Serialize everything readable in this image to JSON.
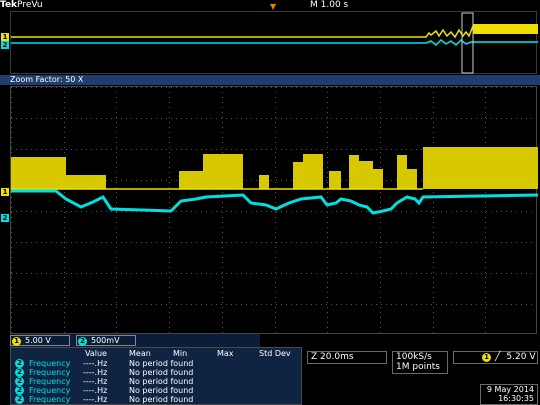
{
  "header": {
    "brand": "Tek",
    "mode": "PreVu",
    "timebase": "M 1.00 s"
  },
  "zoom": {
    "label": "Zoom Factor: 50 X"
  },
  "channels": [
    {
      "num": "1",
      "scale": "5.00 V",
      "color": "#f0e000"
    },
    {
      "num": "2",
      "scale": "500mV",
      "color": "#00e0e0"
    }
  ],
  "measurements": {
    "headers": [
      "Value",
      "Mean",
      "Min",
      "Max",
      "Std Dev"
    ],
    "rows": [
      {
        "ch": "2",
        "name": "Frequency",
        "value": "----.Hz",
        "status": "No period found"
      },
      {
        "ch": "2",
        "name": "Frequency",
        "value": "----.Hz",
        "status": "No period found"
      },
      {
        "ch": "2",
        "name": "Frequency",
        "value": "----.Hz",
        "status": "No period found"
      },
      {
        "ch": "2",
        "name": "Frequency",
        "value": "----.Hz",
        "status": "No period found"
      },
      {
        "ch": "2",
        "name": "Frequency",
        "value": "----.Hz",
        "status": "No period found"
      }
    ]
  },
  "horizontal": {
    "position": "Z 20.0ms",
    "sample_rate": "100kS/s",
    "record_length": "1M points"
  },
  "trigger": {
    "channel": "1",
    "slope_icon": "rising-edge-icon",
    "level": "5.20 V"
  },
  "datetime": {
    "date": "9 May 2014",
    "time": "16:30:35"
  },
  "colors": {
    "ch1": "#f0e000",
    "ch2": "#00e0e0",
    "panel": "#0f2442",
    "zoombar": "#1f3d6e"
  }
}
